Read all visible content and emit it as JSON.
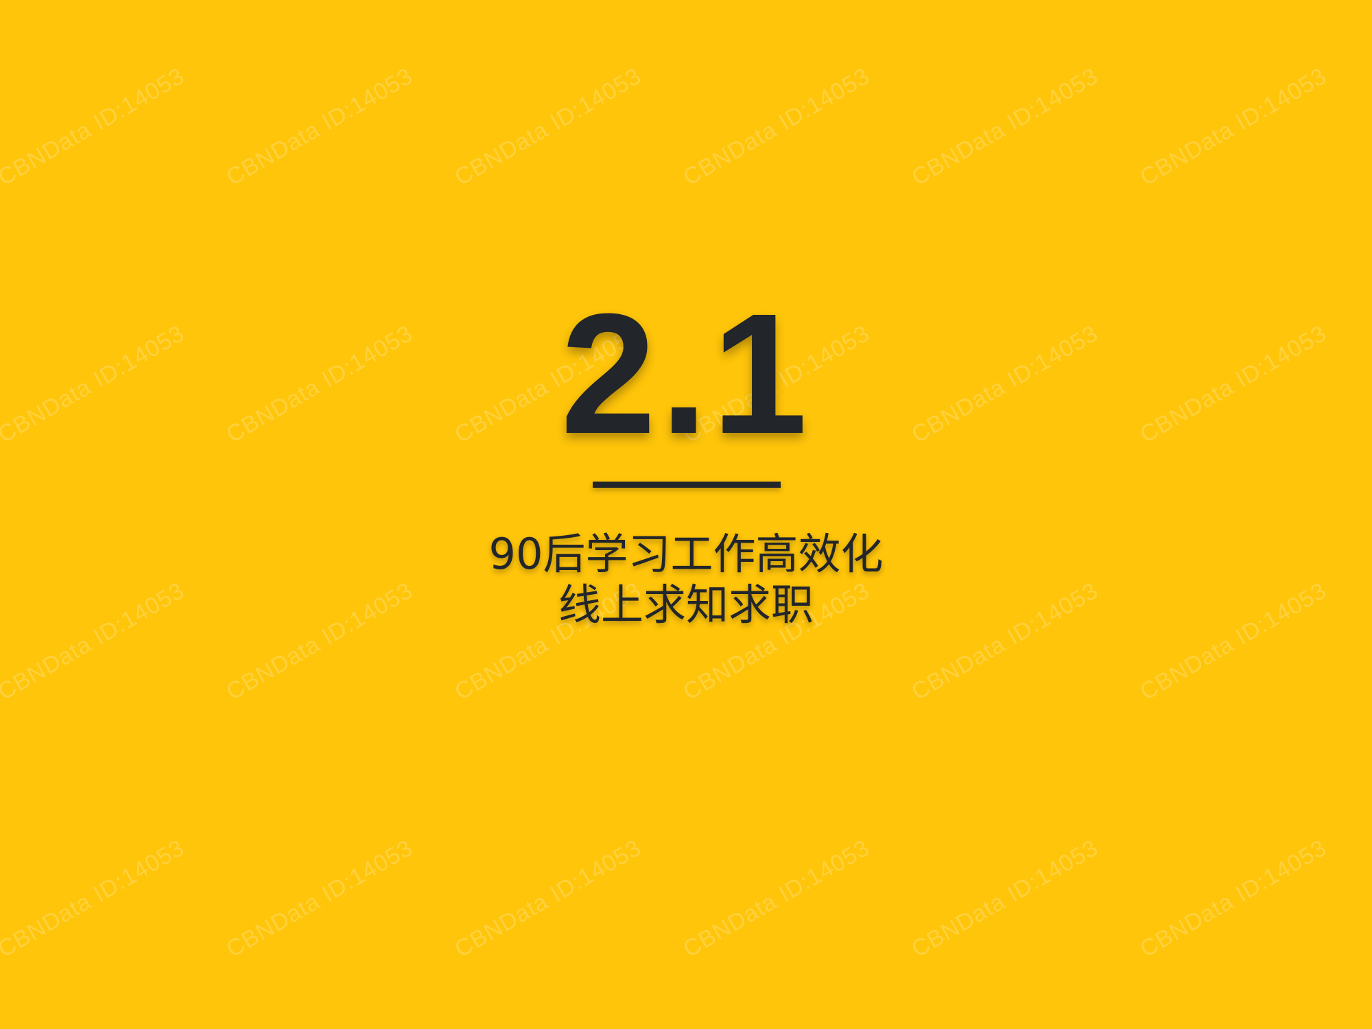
{
  "slide": {
    "section_number": "2.1",
    "subtitle_line1": "90后学习工作高效化",
    "subtitle_line2": "线上求知求职",
    "background_color": "#FFC50A",
    "text_color": "#22252A"
  },
  "watermark": {
    "text": "CBNData ID:14053"
  }
}
